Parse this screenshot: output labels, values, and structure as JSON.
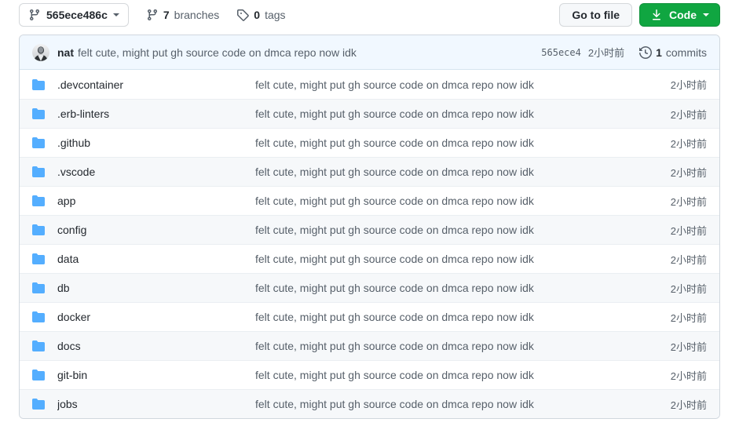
{
  "toolbar": {
    "branch_selector": {
      "icon": "git-branch-icon",
      "label": "565ece486c",
      "caret": "chevron-down-icon"
    },
    "branches": {
      "icon": "git-branch-icon",
      "count": "7",
      "label": "branches"
    },
    "tags": {
      "icon": "tag-icon",
      "count": "0",
      "label": "tags"
    },
    "go_to_file_label": "Go to file",
    "code_button": {
      "icon": "download-icon",
      "label": "Code",
      "caret": "chevron-down-icon",
      "color": "#10a641"
    }
  },
  "commit_bar": {
    "avatar": "user-avatar",
    "author": "nat",
    "message": "felt cute, might put gh source code on dmca repo now idk",
    "sha": "565ece4",
    "time": "2小时前",
    "history_icon": "history-icon",
    "commits_count": "1",
    "commits_label": "commits",
    "background": "#f1f8ff"
  },
  "columns": {
    "name": "",
    "message": "",
    "time": ""
  },
  "files": [
    {
      "icon": "folder-icon",
      "name": ".devcontainer",
      "message": "felt cute, might put gh source code on dmca repo now idk",
      "time": "2小时前"
    },
    {
      "icon": "folder-icon",
      "name": ".erb-linters",
      "message": "felt cute, might put gh source code on dmca repo now idk",
      "time": "2小时前"
    },
    {
      "icon": "folder-icon",
      "name": ".github",
      "message": "felt cute, might put gh source code on dmca repo now idk",
      "time": "2小时前"
    },
    {
      "icon": "folder-icon",
      "name": ".vscode",
      "message": "felt cute, might put gh source code on dmca repo now idk",
      "time": "2小时前"
    },
    {
      "icon": "folder-icon",
      "name": "app",
      "message": "felt cute, might put gh source code on dmca repo now idk",
      "time": "2小时前"
    },
    {
      "icon": "folder-icon",
      "name": "config",
      "message": "felt cute, might put gh source code on dmca repo now idk",
      "time": "2小时前"
    },
    {
      "icon": "folder-icon",
      "name": "data",
      "message": "felt cute, might put gh source code on dmca repo now idk",
      "time": "2小时前"
    },
    {
      "icon": "folder-icon",
      "name": "db",
      "message": "felt cute, might put gh source code on dmca repo now idk",
      "time": "2小时前"
    },
    {
      "icon": "folder-icon",
      "name": "docker",
      "message": "felt cute, might put gh source code on dmca repo now idk",
      "time": "2小时前"
    },
    {
      "icon": "folder-icon",
      "name": "docs",
      "message": "felt cute, might put gh source code on dmca repo now idk",
      "time": "2小时前"
    },
    {
      "icon": "folder-icon",
      "name": "git-bin",
      "message": "felt cute, might put gh source code on dmca repo now idk",
      "time": "2小时前"
    },
    {
      "icon": "folder-icon",
      "name": "jobs",
      "message": "felt cute, might put gh source code on dmca repo now idk",
      "time": "2小时前"
    }
  ],
  "colors": {
    "folder_icon": "#54aeff",
    "border": "#d0d7de",
    "row_alt": "#f6f8fa",
    "text_muted": "#57606a",
    "text_primary": "#24292f"
  }
}
